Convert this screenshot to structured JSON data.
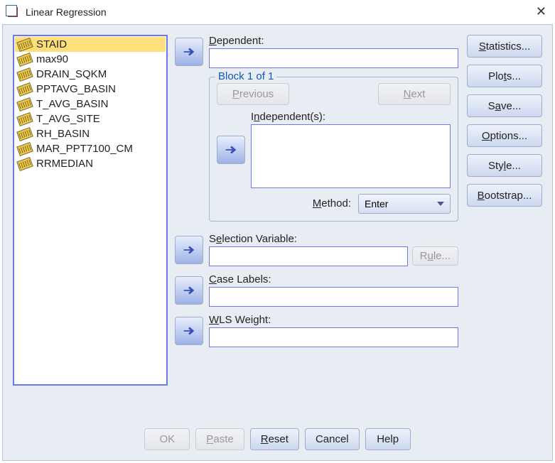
{
  "window": {
    "title": "Linear Regression"
  },
  "variables": [
    "STAID",
    "max90",
    "DRAIN_SQKM",
    "PPTAVG_BASIN",
    "T_AVG_BASIN",
    "T_AVG_SITE",
    "RH_BASIN",
    "MAR_PPT7100_CM",
    "RRMEDIAN"
  ],
  "labels": {
    "dependent": "Dependent:",
    "block": "Block 1 of 1",
    "previous": "Previous",
    "next": "Next",
    "independents": "Independent(s):",
    "method": "Method:",
    "method_value": "Enter",
    "selection_variable": "Selection Variable:",
    "rule": "Rule...",
    "case_labels": "Case Labels:",
    "wls_weight": "WLS Weight:"
  },
  "sidebuttons": {
    "statistics": "Statistics...",
    "plots": "Plots...",
    "save": "Save...",
    "options": "Options...",
    "style": "Style...",
    "bootstrap": "Bootstrap..."
  },
  "bottom": {
    "ok": "OK",
    "paste": "Paste",
    "reset": "Reset",
    "cancel": "Cancel",
    "help": "Help"
  }
}
